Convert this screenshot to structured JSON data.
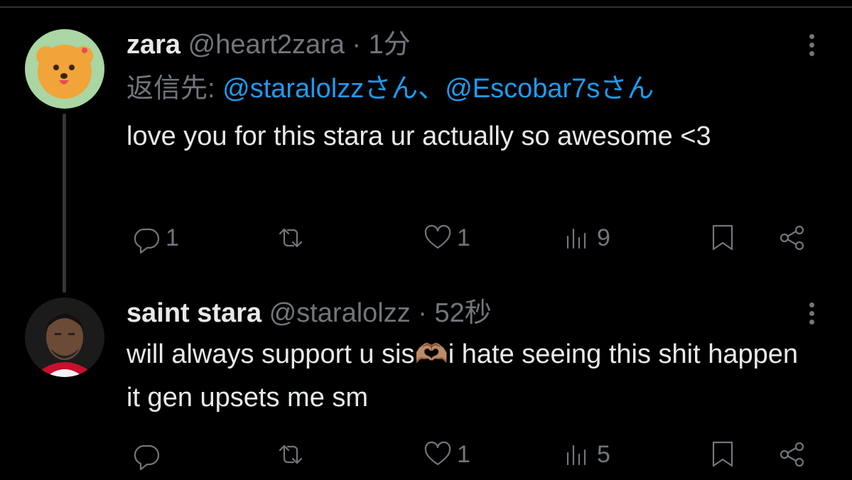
{
  "tweets": [
    {
      "name": "zara",
      "handle": "@heart2zara",
      "sep": " · ",
      "time": "1分",
      "reply_prefix": "返信先: ",
      "reply_user1": "@staralolzz",
      "reply_san1": "さん、",
      "reply_user2": "@Escobar7s",
      "reply_san2": "さん",
      "text": "love you for this stara ur actually so awesome <3",
      "replies": "1",
      "retweets": "",
      "likes": "1",
      "views": "9"
    },
    {
      "name": "saint stara",
      "handle": "@staralolzz",
      "sep": " · ",
      "time": "52秒",
      "text": "will always support u sis🫶🏽i hate seeing this shit happen it gen upsets me sm",
      "replies": "",
      "retweets": "",
      "likes": "1",
      "views": "5"
    }
  ],
  "icons": [
    "more-icon",
    "reply-icon",
    "retweet-icon",
    "like-icon",
    "views-icon",
    "bookmark-icon",
    "share-icon"
  ],
  "colors": {
    "background": "#000000",
    "text": "#e7e9ea",
    "muted": "#71767b",
    "link": "#1d9bf0"
  }
}
